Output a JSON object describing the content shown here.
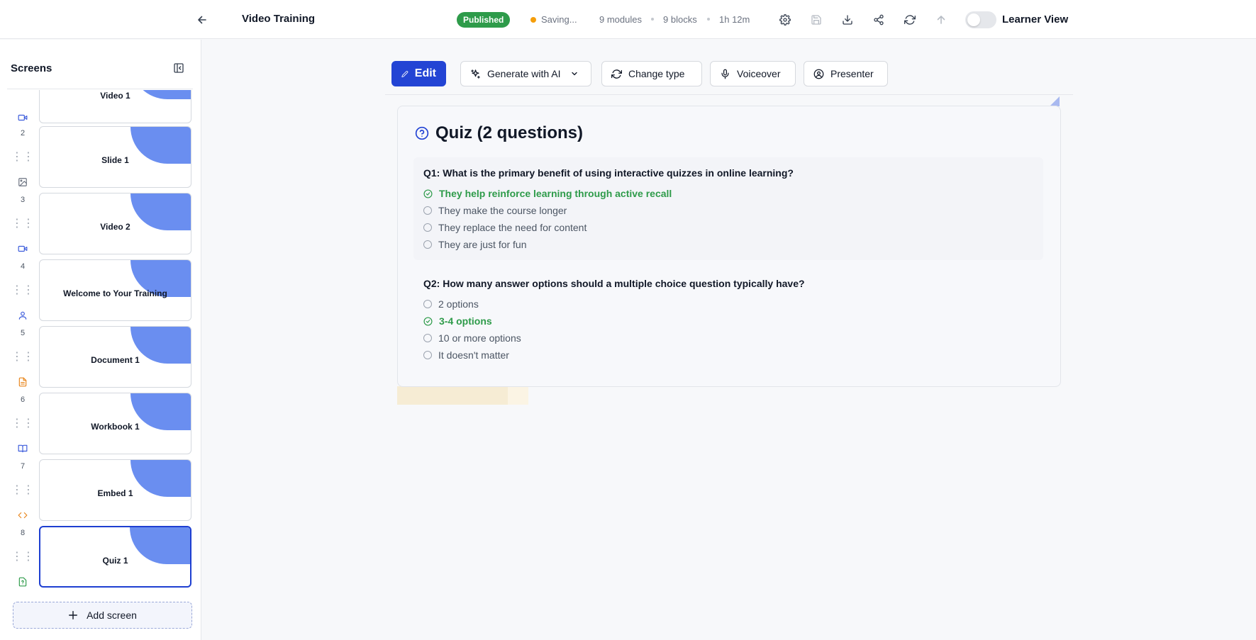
{
  "header": {
    "title": "Video Training",
    "status_badge": "Published",
    "saving_text": "Saving...",
    "modules": "9 modules",
    "blocks": "9 blocks",
    "duration": "1h 12m",
    "learner_view_label": "Learner View",
    "learner_view_on": false,
    "colors": {
      "published": "#2e9b4a",
      "saving_dot": "#f59e0b"
    }
  },
  "sidebar": {
    "title": "Screens",
    "partial_label": "Video 1",
    "items": [
      {
        "number": "2",
        "label": "Slide 1",
        "icon": "image-icon"
      },
      {
        "number": "3",
        "label": "Video 2",
        "icon": "video-icon"
      },
      {
        "number": "4",
        "label": "Welcome to Your Training",
        "icon": "user-icon"
      },
      {
        "number": "5",
        "label": "Document 1",
        "icon": "document-icon"
      },
      {
        "number": "6",
        "label": "Workbook 1",
        "icon": "book-icon"
      },
      {
        "number": "7",
        "label": "Embed 1",
        "icon": "code-icon"
      },
      {
        "number": "8",
        "label": "Quiz 1",
        "icon": "quiz-file-icon",
        "active": true
      }
    ],
    "add_screen_label": "Add screen"
  },
  "toolbar": {
    "edit_label": "Edit",
    "generate_label": "Generate with AI",
    "change_type_label": "Change type",
    "voiceover_label": "Voiceover",
    "presenter_label": "Presenter",
    "accent_color": "#2344d4"
  },
  "quiz": {
    "title": "Quiz (2 questions)",
    "questions": [
      {
        "text": "Q1: What is the primary benefit of using interactive quizzes in online learning?",
        "options": [
          {
            "text": "They help reinforce learning through active recall",
            "correct": true
          },
          {
            "text": "They make the course longer",
            "correct": false
          },
          {
            "text": "They replace the need for content",
            "correct": false
          },
          {
            "text": "They are just for fun",
            "correct": false
          }
        ]
      },
      {
        "text": "Q2: How many answer options should a multiple choice question typically have?",
        "options": [
          {
            "text": "2 options",
            "correct": false
          },
          {
            "text": "3-4 options",
            "correct": true
          },
          {
            "text": "10 or more options",
            "correct": false
          },
          {
            "text": "It doesn't matter",
            "correct": false
          }
        ]
      }
    ],
    "correct_color": "#2e9b4a"
  }
}
